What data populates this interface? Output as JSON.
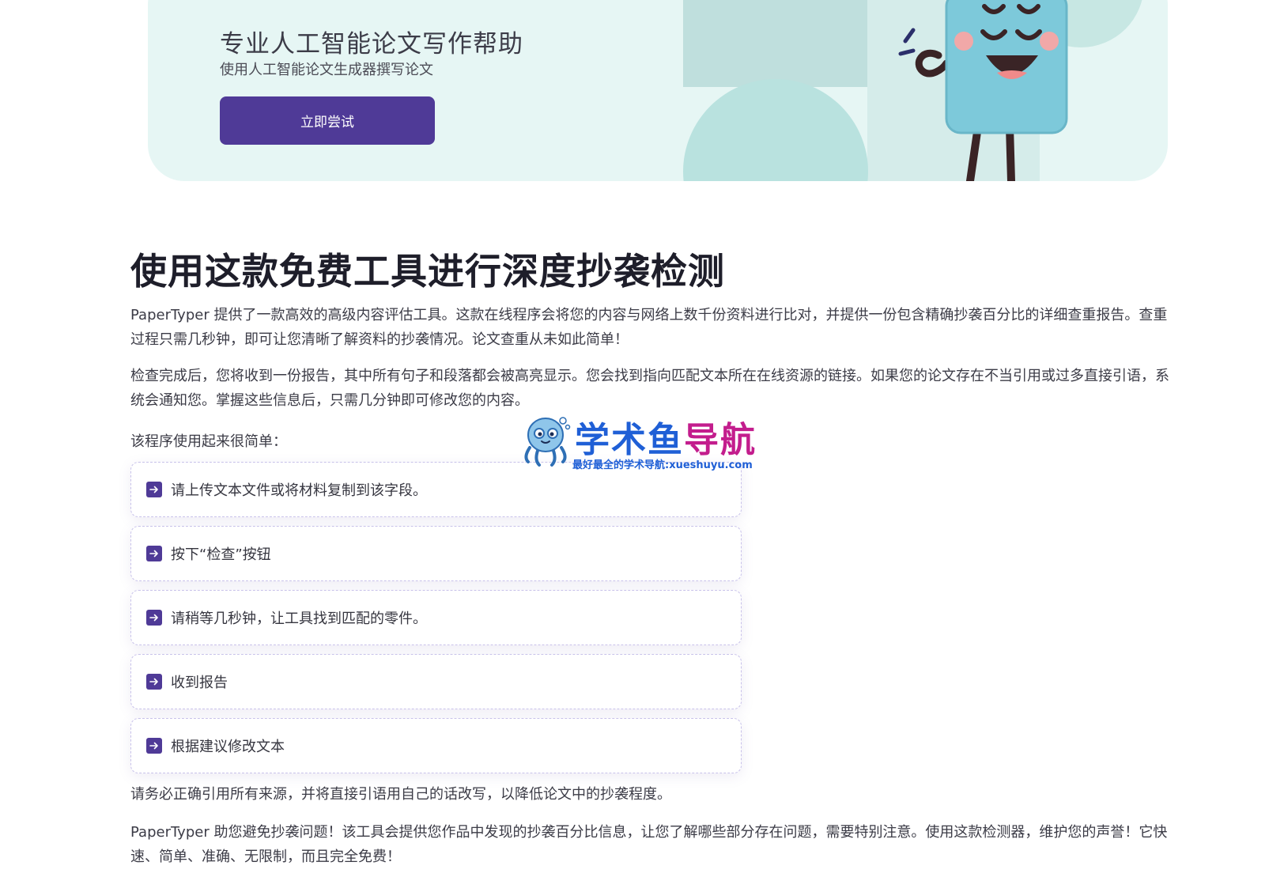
{
  "banner": {
    "title": "专业人工智能论文写作帮助",
    "subtitle": "使用人工智能论文生成器撰写论文",
    "cta_label": "立即尝试"
  },
  "main": {
    "heading": "使用这款免费工具进行深度抄袭检测",
    "paragraphs": [
      "PaperTyper 提供了一款高效的高级内容评估工具。这款在线程序会将您的内容与网络上数千份资料进行比对，并提供一份包含精确抄袭百分比的详细查重报告。查重过程只需几秒钟，即可让您清晰了解资料的抄袭情况。论文查重从未如此简单！",
      "检查完成后，您将收到一份报告，其中所有句子和段落都会被高亮显示。您会找到指向匹配文本所在在线资源的链接。如果您的论文存在不当引用或过多直接引语，系统会通知您。掌握这些信息后，只需几分钟即可修改您的内容。"
    ],
    "steps_intro": "该程序使用起来很简单：",
    "steps": [
      {
        "label": "请上传文本文件或将材料复制到该字段。",
        "icon": "arrow-right-icon"
      },
      {
        "label": "按下“检查”按钮",
        "icon": "arrow-right-icon"
      },
      {
        "label": "请稍等几秒钟，让工具找到匹配的零件。",
        "icon": "arrow-right-icon"
      },
      {
        "label": "收到报告",
        "icon": "arrow-right-icon"
      },
      {
        "label": "根据建议修改文本",
        "icon": "arrow-right-icon"
      }
    ],
    "after_steps": "请务必正确引用所有来源，并将直接引语用自己的话改写，以降低论文中的抄袭程度。",
    "closing": "PaperTyper 助您避免抄袭问题！该工具会提供您作品中发现的抄袭百分比信息，让您了解哪些部分存在问题，需要特别注意。使用这款检测器，维护您的声誉！它快速、简单、准确、无限制，而且完全免费！"
  },
  "watermark": {
    "name_part1": "学术鱼",
    "name_part2": "导航",
    "tagline": "最好最全的学术导航:xueshuyu.com"
  },
  "colors": {
    "accent": "#4f3a97",
    "banner_bg": "#e6f6f4",
    "watermark_blue": "#1f5fd6",
    "watermark_magenta": "#c31d8d"
  }
}
